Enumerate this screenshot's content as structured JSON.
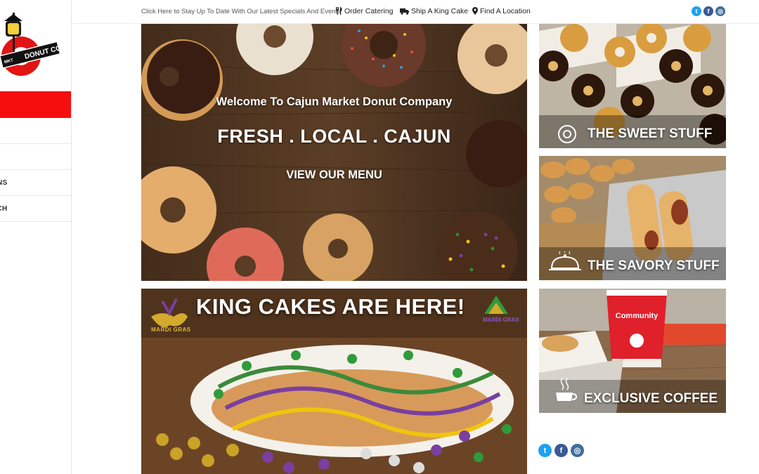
{
  "sidebar": {
    "logo_text": "DONUT CO.",
    "logo_sub": "MKT",
    "nav": [
      {
        "label": ""
      },
      {
        "label": "ONS"
      },
      {
        "label": "RCH"
      }
    ]
  },
  "topbar": {
    "promo": "Click Here to Stay Up To Date With Our Latest Specials And Events",
    "links": [
      {
        "label": "Order Catering",
        "icon": "utensils-icon"
      },
      {
        "label": "Ship A King Cake",
        "icon": "truck-icon"
      },
      {
        "label": "Find A Location",
        "icon": "map-pin-icon"
      }
    ]
  },
  "social": [
    {
      "name": "twitter-icon",
      "glyph": "t"
    },
    {
      "name": "facebook-icon",
      "glyph": "f"
    },
    {
      "name": "instagram-icon",
      "glyph": "◎"
    }
  ],
  "hero": {
    "welcome": "Welcome To Cajun Market Donut Company",
    "tagline": "FRESH . LOCAL . CAJUN",
    "cta": "VIEW OUR MENU"
  },
  "king_cakes": {
    "title": "KING CAKES ARE HERE!",
    "badge_left": "MARDI GRAS",
    "badge_right": "MARDI GRAS"
  },
  "tiles": [
    {
      "label": "THE SWEET STUFF",
      "icon": "donut-icon"
    },
    {
      "label": "THE SAVORY STUFF",
      "icon": "cloche-icon"
    },
    {
      "label": "EXCLUSIVE COFFEE",
      "icon": "coffee-cup-icon"
    }
  ],
  "coffee_cup_brand": "Community",
  "colors": {
    "brand_red": "#f60e0e",
    "twitter": "#1da1f2",
    "facebook": "#3b5998",
    "instagram": "#3f6e9a"
  }
}
